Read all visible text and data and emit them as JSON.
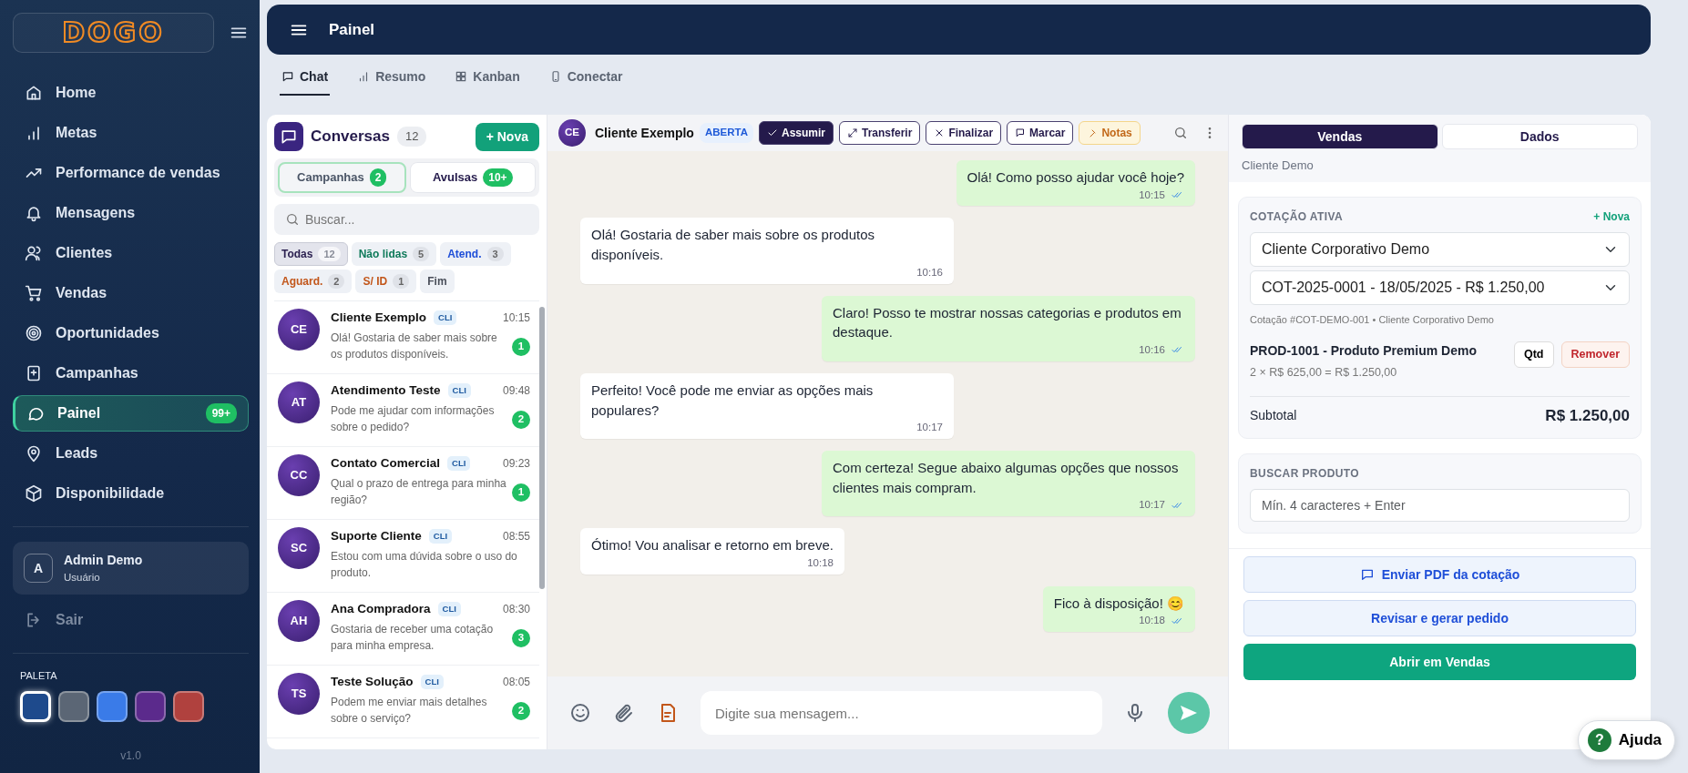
{
  "sidebar": {
    "logo": "DOGO",
    "items": [
      {
        "label": "Home",
        "selected": false
      },
      {
        "label": "Metas",
        "selected": false
      },
      {
        "label": "Performance de vendas",
        "selected": false
      },
      {
        "label": "Mensagens",
        "selected": false
      },
      {
        "label": "Clientes",
        "selected": false
      },
      {
        "label": "Vendas",
        "selected": false
      },
      {
        "label": "Oportunidades",
        "selected": false
      },
      {
        "label": "Campanhas",
        "selected": false
      },
      {
        "label": "Painel",
        "selected": true,
        "badge": "99+"
      },
      {
        "label": "Leads",
        "selected": false
      },
      {
        "label": "Disponibilidade",
        "selected": false
      }
    ],
    "user": {
      "initial": "A",
      "name": "Admin Demo",
      "role": "Usuário"
    },
    "logout": {
      "label": "Sair",
      "disabled": true
    },
    "palette": {
      "title": "PALETA",
      "swatches": [
        {
          "color": "#1e4a8c",
          "selected": true
        },
        {
          "color": "#5b6675",
          "selected": false
        },
        {
          "color": "#3a7be8",
          "selected": false
        },
        {
          "color": "#5b2a8c",
          "selected": false
        },
        {
          "color": "#b0413e",
          "selected": false
        }
      ]
    },
    "version": "v1.0"
  },
  "header": {
    "title": "Painel"
  },
  "tabs": [
    {
      "label": "Chat",
      "selected": true
    },
    {
      "label": "Resumo",
      "selected": false
    },
    {
      "label": "Kanban",
      "selected": false
    },
    {
      "label": "Conectar",
      "selected": false
    }
  ],
  "conversations": {
    "title": "Conversas",
    "count": "12",
    "new_button": "+ Nova",
    "segments": [
      {
        "label": "Campanhas",
        "badge": "2",
        "selected": true
      },
      {
        "label": "Avulsas",
        "badge": "10+",
        "selected": false
      }
    ],
    "search": {
      "placeholder": "Buscar..."
    },
    "filters": [
      {
        "label": "Todas",
        "count": "12",
        "selected": true,
        "color": "#2a1f4f"
      },
      {
        "label": "Não lidas",
        "count": "5",
        "selected": false,
        "color": "#0f7a5a"
      },
      {
        "label": "Atend.",
        "count": "3",
        "selected": false,
        "color": "#1f4fd8"
      },
      {
        "label": "Aguard.",
        "count": "2",
        "selected": false,
        "color": "#c2561a"
      },
      {
        "label": "S/ ID",
        "count": "1",
        "selected": false,
        "color": "#c2561a"
      },
      {
        "label": "Fim",
        "selected": false,
        "color": "#4a4f5a"
      }
    ],
    "items": [
      {
        "initials": "CE",
        "name": "Cliente Exemplo",
        "tag": "CLI",
        "time": "10:15",
        "preview": "Olá! Gostaria de saber mais sobre os produtos disponíveis.",
        "unread": "1"
      },
      {
        "initials": "AT",
        "name": "Atendimento Teste",
        "tag": "CLI",
        "time": "09:48",
        "preview": "Pode me ajudar com informações sobre o pedido?",
        "unread": "2"
      },
      {
        "initials": "CC",
        "name": "Contato Comercial",
        "tag": "CLI",
        "time": "09:23",
        "preview": "Qual o prazo de entrega para minha região?",
        "unread": "1"
      },
      {
        "initials": "SC",
        "name": "Suporte Cliente",
        "tag": "CLI",
        "time": "08:55",
        "preview": "Estou com uma dúvida sobre o uso do produto."
      },
      {
        "initials": "AH",
        "name": "Ana Compradora",
        "tag": "CLI",
        "time": "08:30",
        "preview": "Gostaria de receber uma cotação para minha empresa.",
        "unread": "3"
      },
      {
        "initials": "TS",
        "name": "Teste Solução",
        "tag": "CLI",
        "time": "08:05",
        "preview": "Podem me enviar mais detalhes sobre o serviço?",
        "unread": "2"
      }
    ]
  },
  "chat": {
    "initials": "CE",
    "name": "Cliente Exemplo",
    "status": "ABERTA",
    "actions": [
      {
        "label": "Assumir",
        "kind": "primary"
      },
      {
        "label": "Transferir",
        "kind": "outline"
      },
      {
        "label": "Finalizar",
        "kind": "outline"
      },
      {
        "label": "Marcar",
        "kind": "outline"
      },
      {
        "label": "Notas",
        "kind": "warning"
      }
    ],
    "messages": [
      {
        "kind": "out",
        "text": "Olá! Como posso ajudar você hoje?",
        "time": "10:15",
        "read": true
      },
      {
        "kind": "in",
        "text": "Olá! Gostaria de saber mais sobre os produtos disponíveis.",
        "time": "10:16"
      },
      {
        "kind": "out",
        "text": "Claro! Posso te mostrar nossas categorias e produtos em destaque.",
        "time": "10:16",
        "read": true
      },
      {
        "kind": "in",
        "text": "Perfeito! Você pode me enviar as opções mais populares?",
        "time": "10:17"
      },
      {
        "kind": "out",
        "text": "Com certeza! Segue abaixo algumas opções que nossos clientes mais compram.",
        "time": "10:17",
        "read": true
      },
      {
        "kind": "in",
        "text": "Ótimo! Vou analisar e retorno em breve.",
        "time": "10:18"
      },
      {
        "kind": "out",
        "text": "Fico à disposição! 😊",
        "time": "10:18",
        "read": true
      }
    ],
    "composer": {
      "placeholder": "Digite sua mensagem..."
    }
  },
  "panel": {
    "tabs": [
      {
        "label": "Vendas",
        "selected": true
      },
      {
        "label": "Dados",
        "selected": false
      }
    ],
    "client": "Cliente Demo",
    "quote": {
      "title": "COTAÇÃO ATIVA",
      "new_link": "+ Nova",
      "client_select": "Cliente Corporativo Demo",
      "quote_select": "COT-2025-0001 - 18/05/2025 - R$ 1.250,00",
      "caption": "Cotação #COT-DEMO-001 • Cliente Corporativo Demo",
      "items": [
        {
          "name": "PROD-1001 - Produto Premium Demo",
          "detail": "2 × R$ 625,00 = R$ 1.250,00",
          "qty_button": "Qtd",
          "remove_button": "Remover"
        }
      ],
      "subtotal_label": "Subtotal",
      "subtotal": "R$ 1.250,00"
    },
    "product_search": {
      "title": "BUSCAR PRODUTO",
      "placeholder": "Mín. 4 caracteres + Enter"
    },
    "buttons": [
      {
        "label": "Enviar PDF da cotação",
        "kind": "light",
        "icon": true
      },
      {
        "label": "Revisar e gerar pedido",
        "kind": "light"
      },
      {
        "label": "Abrir em Vendas",
        "kind": "success"
      }
    ]
  },
  "help": {
    "label": "Ajuda",
    "icon": "?"
  }
}
